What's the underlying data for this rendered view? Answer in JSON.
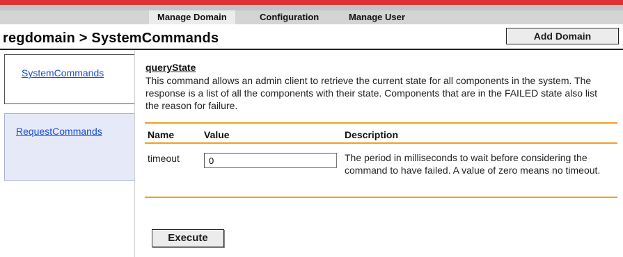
{
  "nav": {
    "tabs": [
      {
        "label": "Manage Domain",
        "active": true
      },
      {
        "label": "Configuration",
        "active": false
      },
      {
        "label": "Manage User",
        "active": false
      }
    ]
  },
  "header": {
    "breadcrumb": "regdomain > SystemCommands",
    "add_domain_label": "Add Domain"
  },
  "sidebar": {
    "items": [
      {
        "label": "SystemCommands",
        "active": true
      },
      {
        "label": "RequestCommands",
        "active": false
      }
    ]
  },
  "command": {
    "name": "queryState",
    "description": "This command allows an admin client to retrieve the current state for all components in the system. The response is a list of all the components with their state. Components that are in the FAILED state also list the reason for failure."
  },
  "params_table": {
    "headers": {
      "name": "Name",
      "value": "Value",
      "description": "Description"
    },
    "rows": [
      {
        "name": "timeout",
        "value": "0",
        "description": "The period in milliseconds to wait before considering the command to have failed. A value of zero means no timeout."
      }
    ]
  },
  "actions": {
    "execute_label": "Execute"
  },
  "colors": {
    "top_bar": "#dd3333",
    "rule": "#f0a020",
    "link": "#1a4fd6",
    "inactive_tab_bg": "#e6eaf8"
  }
}
